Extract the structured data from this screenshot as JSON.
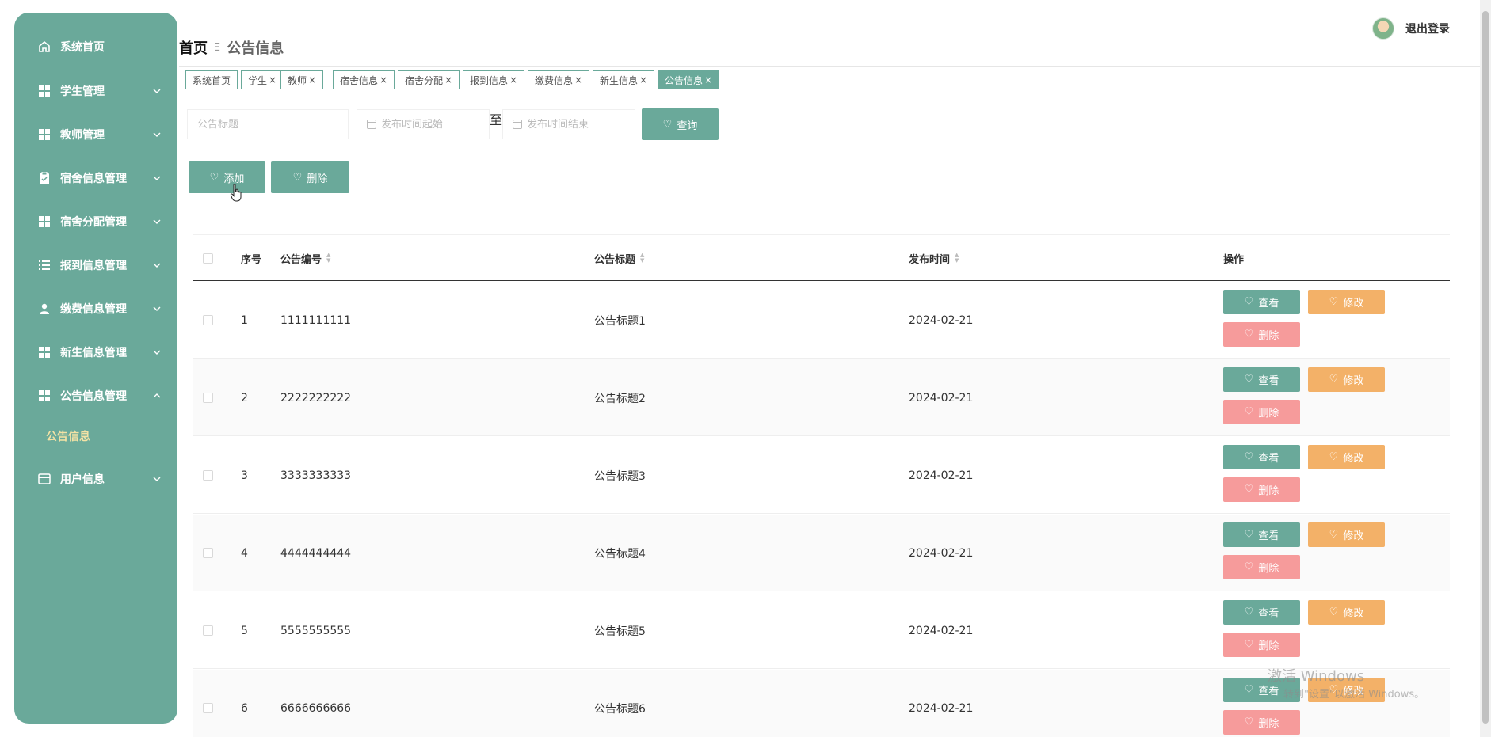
{
  "sidebar": {
    "items": [
      {
        "label": "系统首页",
        "icon": "home-icon",
        "chevron": ""
      },
      {
        "label": "学生管理",
        "icon": "grid-icon",
        "chevron": "down"
      },
      {
        "label": "教师管理",
        "icon": "grid-icon",
        "chevron": "down"
      },
      {
        "label": "宿舍信息管理",
        "icon": "clipboard-icon",
        "chevron": "down"
      },
      {
        "label": "宿舍分配管理",
        "icon": "grid-icon",
        "chevron": "down"
      },
      {
        "label": "报到信息管理",
        "icon": "list-icon",
        "chevron": "down"
      },
      {
        "label": "缴费信息管理",
        "icon": "user-icon",
        "chevron": "down"
      },
      {
        "label": "新生信息管理",
        "icon": "grid-icon",
        "chevron": "down"
      },
      {
        "label": "公告信息管理",
        "icon": "grid-icon",
        "chevron": "up"
      },
      {
        "label": "用户信息",
        "icon": "card-icon",
        "chevron": "down"
      }
    ],
    "submenu": {
      "label": "公告信息"
    }
  },
  "header": {
    "breadcrumb_home": "首页",
    "breadcrumb_sep": "Ξ",
    "breadcrumb_current": "公告信息",
    "logout_label": "退出登录"
  },
  "tabs": [
    {
      "label": "系统首页",
      "closable": false,
      "active": false
    },
    {
      "label": "学生",
      "closable": true,
      "active": false
    },
    {
      "label": "教师",
      "closable": true,
      "active": false
    },
    {
      "label": "宿舍信息",
      "closable": true,
      "active": false
    },
    {
      "label": "宿舍分配",
      "closable": true,
      "active": false
    },
    {
      "label": "报到信息",
      "closable": true,
      "active": false
    },
    {
      "label": "缴费信息",
      "closable": true,
      "active": false
    },
    {
      "label": "新生信息",
      "closable": true,
      "active": false
    },
    {
      "label": "公告信息",
      "closable": true,
      "active": true
    }
  ],
  "tab_close_glyph": "×",
  "search": {
    "title_placeholder": "公告标题",
    "start_placeholder": "发布时间起始",
    "to_label": "至",
    "end_placeholder": "发布时间结束",
    "query_label": "查询"
  },
  "actions": {
    "add_label": "添加",
    "delete_label": "删除"
  },
  "table": {
    "headers": {
      "index": "序号",
      "code": "公告编号",
      "title": "公告标题",
      "time": "发布时间",
      "ops": "操作"
    },
    "row_actions": {
      "view": "查看",
      "edit": "修改",
      "delete": "删除"
    },
    "rows": [
      {
        "index": "1",
        "code": "1111111111",
        "title": "公告标题1",
        "time": "2024-02-21"
      },
      {
        "index": "2",
        "code": "2222222222",
        "title": "公告标题2",
        "time": "2024-02-21"
      },
      {
        "index": "3",
        "code": "3333333333",
        "title": "公告标题3",
        "time": "2024-02-21"
      },
      {
        "index": "4",
        "code": "4444444444",
        "title": "公告标题4",
        "time": "2024-02-21"
      },
      {
        "index": "5",
        "code": "5555555555",
        "title": "公告标题5",
        "time": "2024-02-21"
      },
      {
        "index": "6",
        "code": "6666666666",
        "title": "公告标题6",
        "time": "2024-02-21"
      }
    ]
  },
  "watermark": {
    "line1": "激活 Windows",
    "line2": "转到\"设置\"以激活 Windows。"
  },
  "colors": {
    "primary": "#6aa99a",
    "orange": "#f3b168",
    "pink": "#f69b9b",
    "submenu_active": "#f3e2a5"
  }
}
